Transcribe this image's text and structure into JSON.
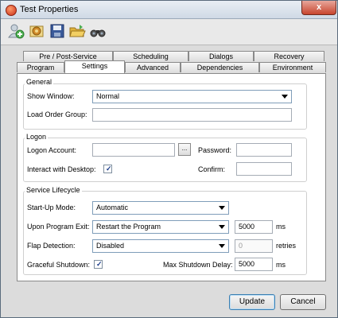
{
  "window": {
    "title": "Test Properties",
    "close_glyph": "x"
  },
  "toolbar": {
    "buttons": [
      {
        "name": "add-user-icon",
        "color": "#4caf50"
      },
      {
        "name": "settings-icon",
        "color": "#d08a2a"
      },
      {
        "name": "save-icon",
        "color": "#3a5a9a"
      },
      {
        "name": "open-folder-icon",
        "color": "#e0b23a"
      },
      {
        "name": "binoculars-icon",
        "color": "#555555"
      }
    ]
  },
  "tabs": {
    "row_back": [
      "Pre / Post-Service",
      "Scheduling",
      "Dialogs",
      "Recovery"
    ],
    "row_front": [
      "Program",
      "Settings",
      "Advanced",
      "Dependencies",
      "Environment"
    ],
    "active": "Settings"
  },
  "general": {
    "label": "General",
    "show_window_label": "Show Window:",
    "show_window_value": "Normal",
    "load_order_label": "Load Order Group:",
    "load_order_value": ""
  },
  "logon": {
    "label": "Logon",
    "account_label": "Logon Account:",
    "account_value": "",
    "browse_label": "...",
    "password_label": "Password:",
    "password_value": "",
    "interact_label": "Interact with Desktop:",
    "interact_checked": true,
    "confirm_label": "Confirm:",
    "confirm_value": ""
  },
  "lifecycle": {
    "label": "Service Lifecycle",
    "startup_label": "Start-Up Mode:",
    "startup_value": "Automatic",
    "exit_label": "Upon Program Exit:",
    "exit_value": "Restart the Program",
    "exit_delay": "5000",
    "exit_unit": "ms",
    "flap_label": "Flap Detection:",
    "flap_value": "Disabled",
    "flap_retries": "0",
    "flap_unit": "retries",
    "graceful_label": "Graceful Shutdown:",
    "graceful_checked": true,
    "max_delay_label": "Max Shutdown Delay:",
    "max_delay_value": "5000",
    "max_delay_unit": "ms"
  },
  "footer": {
    "update_label": "Update",
    "cancel_label": "Cancel"
  },
  "check_glyph": "✓"
}
